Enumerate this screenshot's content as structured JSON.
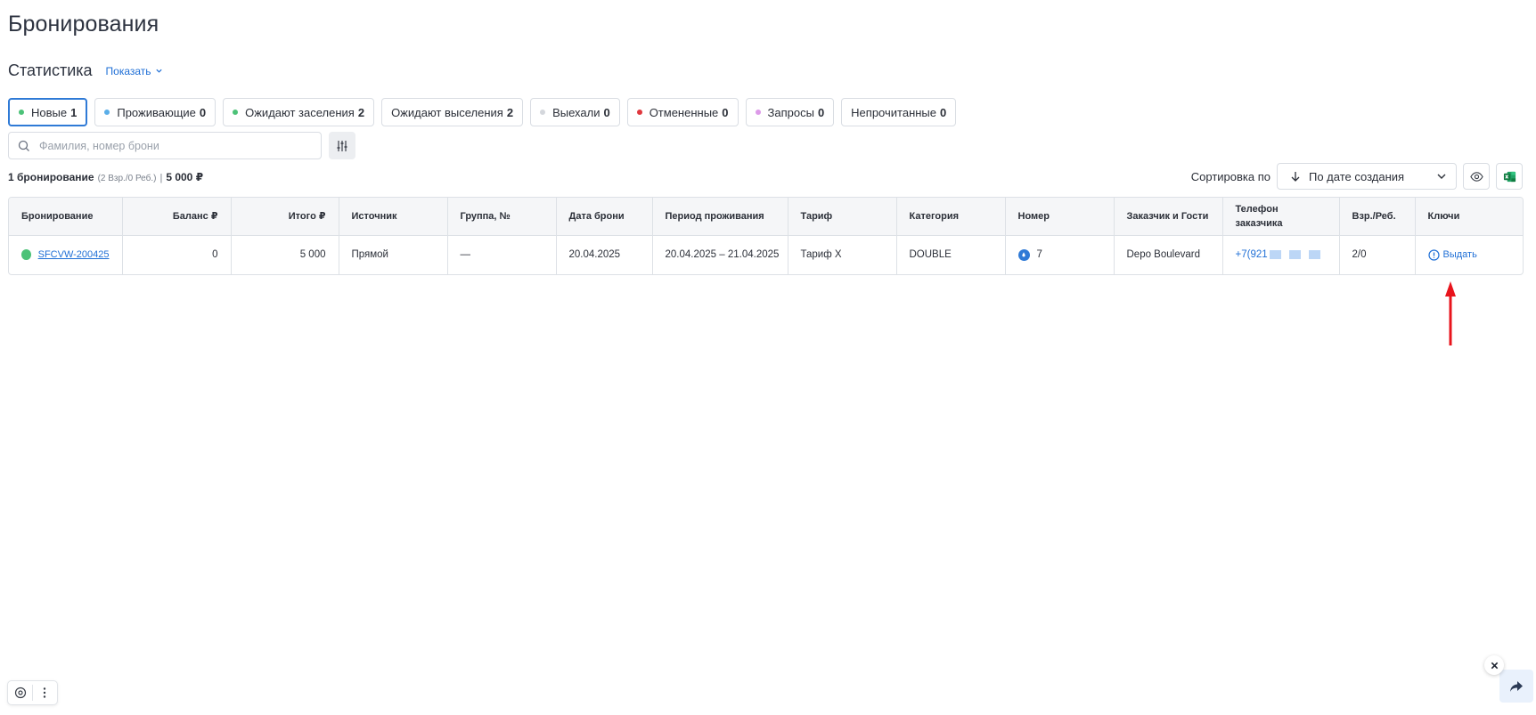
{
  "page": {
    "title": "Бронирования"
  },
  "stats": {
    "title": "Статистика",
    "toggle_label": "Показать"
  },
  "filters": [
    {
      "label": "Новые",
      "count": "1",
      "dot_color": "#4cc278",
      "active": true
    },
    {
      "label": "Проживающие",
      "count": "0",
      "dot_color": "#5aaee8"
    },
    {
      "label": "Ожидают заселения",
      "count": "2",
      "dot_color": "#4cc278"
    },
    {
      "label": "Ожидают выселения",
      "count": "2",
      "dot_color": ""
    },
    {
      "label": "Выехали",
      "count": "0",
      "dot_color": "#d4d7dc"
    },
    {
      "label": "Отмененные",
      "count": "0",
      "dot_color": "#e0383e"
    },
    {
      "label": "Запросы",
      "count": "0",
      "dot_color": "#dc9ae8"
    },
    {
      "label": "Непрочитанные",
      "count": "0",
      "dot_color": ""
    }
  ],
  "search": {
    "placeholder": "Фамилия, номер брони"
  },
  "summary": {
    "count_text": "1 бронирование",
    "guests_text": "(2 Взр./0 Реб.)",
    "separator": "|",
    "total": "5 000 ₽"
  },
  "sort": {
    "label": "Сортировка по",
    "value": "По дате создания"
  },
  "table": {
    "headers": {
      "booking": "Бронирование",
      "balance": "Баланс ₽",
      "total": "Итого ₽",
      "source": "Источник",
      "group": "Группа, №",
      "booking_date": "Дата брони",
      "stay_period": "Период проживания",
      "tariff": "Тариф",
      "category": "Категория",
      "room": "Номер",
      "customer": "Заказчик и Гости",
      "phone_line1": "Телефон",
      "phone_line2": "заказчика",
      "adults_children": "Взр./Реб.",
      "keys": "Ключи"
    },
    "rows": [
      {
        "status_color": "#4cc278",
        "booking_id": "SFCVW-200425",
        "balance": "0",
        "total": "5 000",
        "source": "Прямой",
        "group": "—",
        "booking_date": "20.04.2025",
        "stay_period": "20.04.2025 – 21.04.2025",
        "tariff": "Тариф X",
        "category": "DOUBLE",
        "room": "7",
        "customer": "Depo Boulevard",
        "phone": "+7(921",
        "adults_children": "2/0",
        "keys_action": "Выдать"
      }
    ]
  },
  "colors": {
    "accent": "#1f6fd6",
    "annotation_arrow": "#e8141c"
  }
}
